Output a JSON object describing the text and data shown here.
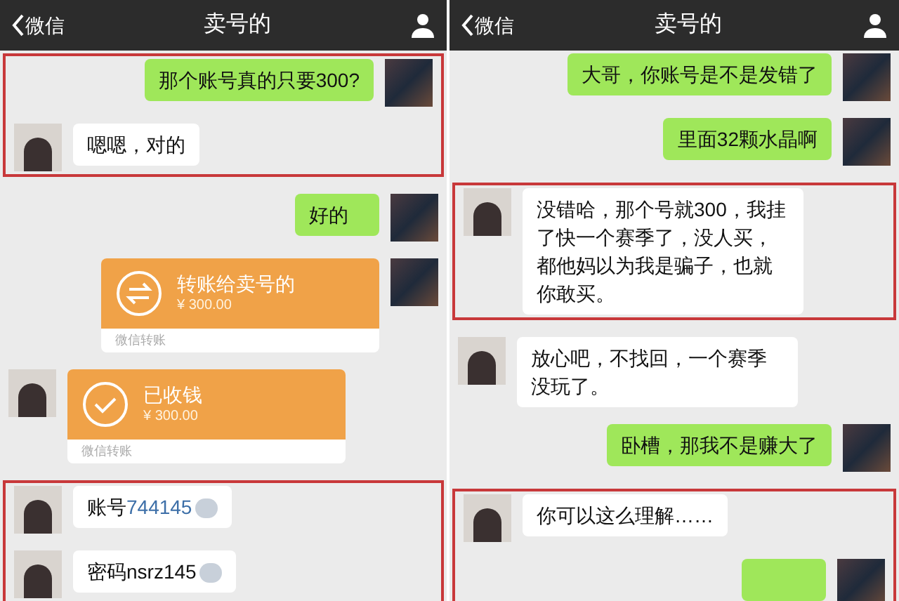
{
  "panels": [
    {
      "header": {
        "back": "微信",
        "title": "卖号的"
      },
      "items": [
        {
          "kind": "highlight",
          "messages": [
            {
              "kind": "text",
              "outgoing": true,
              "text": "那个账号真的只要300?"
            },
            {
              "kind": "text",
              "outgoing": false,
              "text": "嗯嗯，对的"
            }
          ]
        },
        {
          "kind": "text",
          "outgoing": true,
          "text": "好的"
        },
        {
          "kind": "transfer",
          "outgoing": true,
          "received": false,
          "title": "转账给卖号的",
          "amount": "¥ 300.00",
          "footer": "微信转账"
        },
        {
          "kind": "transfer",
          "outgoing": false,
          "received": true,
          "title": "已收钱",
          "amount": "¥ 300.00",
          "footer": "微信转账"
        },
        {
          "kind": "highlight",
          "messages": [
            {
              "kind": "text",
              "outgoing": false,
              "text": "账号",
              "number": "744145",
              "blurred": true
            },
            {
              "kind": "text",
              "outgoing": false,
              "text": "密码nsrz145",
              "blurred": true
            }
          ]
        }
      ]
    },
    {
      "header": {
        "back": "微信",
        "title": "卖号的"
      },
      "items": [
        {
          "kind": "text",
          "outgoing": true,
          "text": "大哥，你账号是不是发错了"
        },
        {
          "kind": "text",
          "outgoing": true,
          "text": "里面32颗水晶啊"
        },
        {
          "kind": "highlight",
          "messages": [
            {
              "kind": "text",
              "outgoing": false,
              "text": "没错哈，那个号就300，我挂了快一个赛季了，没人买，都他妈以为我是骗子，也就你敢买。"
            }
          ]
        },
        {
          "kind": "text",
          "outgoing": false,
          "text": "放心吧，不找回，一个赛季没玩了。"
        },
        {
          "kind": "text",
          "outgoing": true,
          "text": "卧槽，那我不是赚大了"
        },
        {
          "kind": "highlight",
          "messages": [
            {
              "kind": "text",
              "outgoing": false,
              "text": "你可以这么理解……"
            },
            {
              "kind": "text",
              "outgoing": true
            }
          ]
        }
      ]
    }
  ]
}
